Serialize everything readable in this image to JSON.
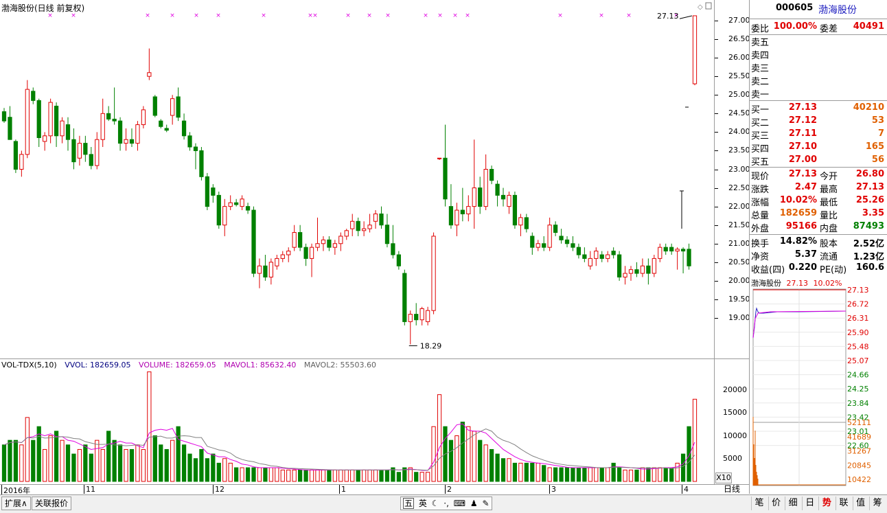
{
  "chart_header": {
    "title": "渤海股份(日线 前复权)",
    "last_price_label": "27.13",
    "low_label": "18.29"
  },
  "price_axis": [
    "27.00",
    "26.50",
    "26.00",
    "25.50",
    "25.00",
    "24.50",
    "24.00",
    "23.50",
    "23.00",
    "22.50",
    "22.00",
    "21.50",
    "21.00",
    "20.50",
    "20.00",
    "19.50",
    "19.00"
  ],
  "volume_header": {
    "indicator": "VOL-TDX(5,10)",
    "vvol": "VVOL: 182659.05",
    "volume": "VOLUME: 182659.05",
    "mavol1": "MAVOL1: 85632.40",
    "mavol2": "MAVOL2: 55503.60"
  },
  "volume_axis": [
    "20000",
    "15000",
    "10000",
    "5000"
  ],
  "x10_label": "X10",
  "date_axis": [
    "2016年",
    "11",
    "12",
    "1",
    "2",
    "3",
    "4"
  ],
  "period_label": "日线",
  "quote": {
    "code": "000605",
    "name": "渤海股份",
    "weibi_label": "委比",
    "weibi": "100.00%",
    "weicha_label": "委差",
    "weicha": "40491",
    "sell": [
      {
        "label": "卖五",
        "price": "",
        "vol": ""
      },
      {
        "label": "卖四",
        "price": "",
        "vol": ""
      },
      {
        "label": "卖三",
        "price": "",
        "vol": ""
      },
      {
        "label": "卖二",
        "price": "",
        "vol": ""
      },
      {
        "label": "卖一",
        "price": "",
        "vol": ""
      }
    ],
    "buy": [
      {
        "label": "买一",
        "price": "27.13",
        "vol": "40210"
      },
      {
        "label": "买二",
        "price": "27.12",
        "vol": "53"
      },
      {
        "label": "买三",
        "price": "27.11",
        "vol": "7"
      },
      {
        "label": "买四",
        "price": "27.10",
        "vol": "165"
      },
      {
        "label": "买五",
        "price": "27.00",
        "vol": "56"
      }
    ],
    "stats": [
      {
        "l1": "现价",
        "v1": "27.13",
        "c1": "red",
        "l2": "今开",
        "v2": "26.80",
        "c2": "red"
      },
      {
        "l1": "涨跌",
        "v1": "2.47",
        "c1": "red",
        "l2": "最高",
        "v2": "27.13",
        "c2": "red"
      },
      {
        "l1": "涨幅",
        "v1": "10.02%",
        "c1": "red",
        "l2": "最低",
        "v2": "25.26",
        "c2": "red"
      },
      {
        "l1": "总量",
        "v1": "182659",
        "c1": "orange",
        "l2": "量比",
        "v2": "3.35",
        "c2": "red"
      },
      {
        "l1": "外盘",
        "v1": "95166",
        "c1": "red",
        "l2": "内盘",
        "v2": "87493",
        "c2": "green"
      }
    ],
    "stats2": [
      {
        "l1": "换手",
        "v1": "14.82%",
        "l2": "股本",
        "v2": "2.52亿"
      },
      {
        "l1": "净资",
        "v1": "5.37",
        "l2": "流通",
        "v2": "1.23亿"
      },
      {
        "l1": "收益(四)",
        "v1": "0.220",
        "l2": "PE(动)",
        "v2": "160.6"
      }
    ]
  },
  "mini": {
    "name": "渤海股份",
    "price": "27.13",
    "pct": "10.02%",
    "price_axis": [
      "27.13",
      "26.72",
      "26.31",
      "25.90",
      "25.48",
      "25.07",
      "24.66",
      "24.25",
      "23.84",
      "23.42",
      "23.01",
      "22.60"
    ],
    "vol_axis": [
      "52111",
      "41689",
      "31267",
      "20845",
      "10422"
    ]
  },
  "bottom_tabs": {
    "expand": "扩展∧",
    "related": "关联报价"
  },
  "ime": {
    "mode": "五",
    "lang": "英",
    "moon": "☾",
    "dot": "·,",
    "kbd": "⌨",
    "person": "♟",
    "wrench": "✎"
  },
  "right_tabs": [
    "笔",
    "价",
    "细",
    "日",
    "势",
    "联",
    "值",
    "筹"
  ],
  "active_right_tab": "势",
  "chart_data": {
    "type": "candlestick",
    "title": "渤海股份(日线 前复权)",
    "x_ticks": [
      "2016年",
      "11",
      "12",
      "1",
      "2",
      "3",
      "4"
    ],
    "ylim": [
      18.5,
      27.2
    ],
    "volume_ylim": [
      0,
      24000
    ],
    "candles": [
      {
        "o": 24.55,
        "h": 24.65,
        "l": 24.25,
        "c": 24.3
      },
      {
        "o": 24.4,
        "h": 24.7,
        "l": 23.9,
        "c": 23.8
      },
      {
        "o": 23.75,
        "h": 23.8,
        "l": 22.9,
        "c": 23.0
      },
      {
        "o": 23.0,
        "h": 23.5,
        "l": 22.8,
        "c": 23.4
      },
      {
        "o": 23.4,
        "h": 25.4,
        "l": 23.3,
        "c": 25.15
      },
      {
        "o": 25.1,
        "h": 25.2,
        "l": 24.75,
        "c": 24.85
      },
      {
        "o": 24.85,
        "h": 24.9,
        "l": 23.6,
        "c": 23.85
      },
      {
        "o": 23.75,
        "h": 24.0,
        "l": 23.5,
        "c": 23.9
      },
      {
        "o": 23.9,
        "h": 24.9,
        "l": 23.7,
        "c": 24.8
      },
      {
        "o": 24.7,
        "h": 24.8,
        "l": 23.6,
        "c": 23.9
      },
      {
        "o": 23.9,
        "h": 24.4,
        "l": 23.7,
        "c": 24.3
      },
      {
        "o": 24.2,
        "h": 24.4,
        "l": 23.5,
        "c": 23.8
      },
      {
        "o": 23.8,
        "h": 24.1,
        "l": 23.0,
        "c": 23.2
      },
      {
        "o": 23.3,
        "h": 23.9,
        "l": 23.1,
        "c": 23.7
      },
      {
        "o": 23.7,
        "h": 23.9,
        "l": 23.2,
        "c": 23.4
      },
      {
        "o": 23.4,
        "h": 23.6,
        "l": 23.0,
        "c": 23.1
      },
      {
        "o": 23.1,
        "h": 24.0,
        "l": 23.0,
        "c": 23.8
      },
      {
        "o": 23.8,
        "h": 24.9,
        "l": 23.6,
        "c": 24.5
      },
      {
        "o": 24.5,
        "h": 24.7,
        "l": 24.3,
        "c": 24.35
      },
      {
        "o": 24.35,
        "h": 25.2,
        "l": 24.2,
        "c": 24.3
      },
      {
        "o": 24.3,
        "h": 24.4,
        "l": 23.5,
        "c": 23.7
      },
      {
        "o": 23.7,
        "h": 24.1,
        "l": 23.5,
        "c": 23.8
      },
      {
        "o": 23.8,
        "h": 24.1,
        "l": 23.6,
        "c": 23.7
      },
      {
        "o": 23.7,
        "h": 24.3,
        "l": 23.5,
        "c": 24.2
      },
      {
        "o": 24.2,
        "h": 24.7,
        "l": 24.1,
        "c": 24.6
      },
      {
        "o": 25.5,
        "h": 26.25,
        "l": 25.4,
        "c": 25.6
      },
      {
        "o": 24.95,
        "h": 25.0,
        "l": 24.4,
        "c": 24.45
      },
      {
        "o": 24.3,
        "h": 24.35,
        "l": 24.1,
        "c": 24.15
      },
      {
        "o": 24.1,
        "h": 24.2,
        "l": 24.0,
        "c": 24.05
      },
      {
        "o": 24.45,
        "h": 25.0,
        "l": 24.2,
        "c": 24.9
      },
      {
        "o": 24.95,
        "h": 25.2,
        "l": 24.3,
        "c": 24.4
      },
      {
        "o": 24.3,
        "h": 24.5,
        "l": 23.8,
        "c": 23.9
      },
      {
        "o": 23.9,
        "h": 24.0,
        "l": 23.5,
        "c": 23.6
      },
      {
        "o": 23.6,
        "h": 23.7,
        "l": 23.0,
        "c": 23.5
      },
      {
        "o": 23.5,
        "h": 23.6,
        "l": 22.7,
        "c": 22.8
      },
      {
        "o": 22.8,
        "h": 22.9,
        "l": 21.9,
        "c": 22.0
      },
      {
        "o": 22.5,
        "h": 22.6,
        "l": 22.1,
        "c": 22.3
      },
      {
        "o": 22.3,
        "h": 22.4,
        "l": 21.4,
        "c": 21.5
      },
      {
        "o": 21.5,
        "h": 22.2,
        "l": 21.2,
        "c": 22.0
      },
      {
        "o": 22.0,
        "h": 22.3,
        "l": 21.9,
        "c": 22.1
      },
      {
        "o": 22.1,
        "h": 22.2,
        "l": 22.0,
        "c": 22.05
      },
      {
        "o": 22.0,
        "h": 22.3,
        "l": 21.9,
        "c": 22.2
      },
      {
        "o": 22.0,
        "h": 22.1,
        "l": 21.8,
        "c": 21.9
      },
      {
        "o": 21.9,
        "h": 22.0,
        "l": 20.1,
        "c": 20.2
      },
      {
        "o": 20.2,
        "h": 20.6,
        "l": 19.8,
        "c": 20.4
      },
      {
        "o": 20.4,
        "h": 20.7,
        "l": 20.0,
        "c": 20.1
      },
      {
        "o": 20.1,
        "h": 20.6,
        "l": 19.9,
        "c": 20.5
      },
      {
        "o": 20.4,
        "h": 20.7,
        "l": 20.3,
        "c": 20.6
      },
      {
        "o": 20.6,
        "h": 20.8,
        "l": 20.5,
        "c": 20.7
      },
      {
        "o": 20.7,
        "h": 20.9,
        "l": 20.5,
        "c": 20.8
      },
      {
        "o": 20.9,
        "h": 21.5,
        "l": 20.8,
        "c": 21.3
      },
      {
        "o": 21.3,
        "h": 21.5,
        "l": 20.8,
        "c": 20.9
      },
      {
        "o": 20.9,
        "h": 21.0,
        "l": 20.4,
        "c": 20.6
      },
      {
        "o": 20.6,
        "h": 21.0,
        "l": 20.1,
        "c": 20.9
      },
      {
        "o": 20.9,
        "h": 21.7,
        "l": 20.8,
        "c": 21.0
      },
      {
        "o": 21.0,
        "h": 21.2,
        "l": 20.8,
        "c": 21.1
      },
      {
        "o": 21.1,
        "h": 21.2,
        "l": 20.8,
        "c": 20.9
      },
      {
        "o": 20.9,
        "h": 21.1,
        "l": 20.7,
        "c": 21.0
      },
      {
        "o": 21.0,
        "h": 21.3,
        "l": 20.8,
        "c": 21.2
      },
      {
        "o": 21.2,
        "h": 21.4,
        "l": 21.1,
        "c": 21.35
      },
      {
        "o": 21.4,
        "h": 21.8,
        "l": 21.2,
        "c": 21.6
      },
      {
        "o": 21.6,
        "h": 21.7,
        "l": 21.2,
        "c": 21.35
      },
      {
        "o": 21.35,
        "h": 21.6,
        "l": 21.2,
        "c": 21.4
      },
      {
        "o": 21.4,
        "h": 21.8,
        "l": 21.3,
        "c": 21.5
      },
      {
        "o": 21.6,
        "h": 21.9,
        "l": 21.4,
        "c": 21.8
      },
      {
        "o": 21.8,
        "h": 22.0,
        "l": 21.4,
        "c": 21.5
      },
      {
        "o": 21.5,
        "h": 21.8,
        "l": 20.9,
        "c": 21.0
      },
      {
        "o": 21.0,
        "h": 21.5,
        "l": 20.6,
        "c": 20.7
      },
      {
        "o": 20.7,
        "h": 20.8,
        "l": 20.3,
        "c": 20.4
      },
      {
        "o": 20.2,
        "h": 20.3,
        "l": 18.8,
        "c": 18.9
      },
      {
        "o": 18.9,
        "h": 19.2,
        "l": 18.29,
        "c": 19.1
      },
      {
        "o": 19.1,
        "h": 19.4,
        "l": 18.8,
        "c": 18.95
      },
      {
        "o": 18.95,
        "h": 19.3,
        "l": 18.8,
        "c": 19.25
      },
      {
        "o": 18.9,
        "h": 19.3,
        "l": 18.8,
        "c": 19.2
      },
      {
        "o": 19.2,
        "h": 21.3,
        "l": 19.1,
        "c": 21.2
      },
      {
        "o": 23.3,
        "h": 23.3,
        "l": 23.25,
        "c": 23.3
      },
      {
        "o": 23.3,
        "h": 24.2,
        "l": 22.0,
        "c": 22.2
      },
      {
        "o": 22.0,
        "h": 22.6,
        "l": 21.4,
        "c": 21.5
      },
      {
        "o": 21.5,
        "h": 22.1,
        "l": 21.2,
        "c": 21.9
      },
      {
        "o": 21.9,
        "h": 22.5,
        "l": 21.6,
        "c": 21.8
      },
      {
        "o": 21.8,
        "h": 22.3,
        "l": 21.6,
        "c": 22.0
      },
      {
        "o": 22.0,
        "h": 23.8,
        "l": 21.4,
        "c": 22.5
      },
      {
        "o": 22.5,
        "h": 22.8,
        "l": 21.8,
        "c": 22.0
      },
      {
        "o": 22.0,
        "h": 23.4,
        "l": 21.9,
        "c": 23.0
      },
      {
        "o": 23.0,
        "h": 23.1,
        "l": 22.6,
        "c": 22.7
      },
      {
        "o": 22.6,
        "h": 22.7,
        "l": 22.0,
        "c": 22.3
      },
      {
        "o": 22.3,
        "h": 22.5,
        "l": 22.0,
        "c": 22.2
      },
      {
        "o": 22.0,
        "h": 22.4,
        "l": 21.8,
        "c": 22.3
      },
      {
        "o": 22.3,
        "h": 22.4,
        "l": 21.4,
        "c": 21.5
      },
      {
        "o": 21.5,
        "h": 21.8,
        "l": 21.2,
        "c": 21.7
      },
      {
        "o": 21.7,
        "h": 21.8,
        "l": 21.3,
        "c": 21.4
      },
      {
        "o": 21.2,
        "h": 21.3,
        "l": 20.7,
        "c": 20.9
      },
      {
        "o": 20.9,
        "h": 21.1,
        "l": 20.8,
        "c": 21.0
      },
      {
        "o": 21.0,
        "h": 21.2,
        "l": 20.8,
        "c": 20.9
      },
      {
        "o": 20.9,
        "h": 21.7,
        "l": 20.8,
        "c": 21.5
      },
      {
        "o": 21.5,
        "h": 21.6,
        "l": 21.2,
        "c": 21.3
      },
      {
        "o": 21.2,
        "h": 21.4,
        "l": 21.0,
        "c": 21.1
      },
      {
        "o": 21.1,
        "h": 21.2,
        "l": 20.9,
        "c": 21.0
      },
      {
        "o": 21.0,
        "h": 21.2,
        "l": 20.8,
        "c": 20.9
      },
      {
        "o": 20.9,
        "h": 21.0,
        "l": 20.6,
        "c": 20.7
      },
      {
        "o": 20.7,
        "h": 20.9,
        "l": 20.5,
        "c": 20.6
      },
      {
        "o": 20.4,
        "h": 20.8,
        "l": 20.3,
        "c": 20.6
      },
      {
        "o": 20.6,
        "h": 20.9,
        "l": 20.4,
        "c": 20.8
      },
      {
        "o": 20.7,
        "h": 20.8,
        "l": 20.5,
        "c": 20.6
      },
      {
        "o": 20.6,
        "h": 20.8,
        "l": 20.5,
        "c": 20.7
      },
      {
        "o": 20.8,
        "h": 20.9,
        "l": 20.6,
        "c": 20.7
      },
      {
        "o": 20.7,
        "h": 20.8,
        "l": 20.0,
        "c": 20.1
      },
      {
        "o": 20.1,
        "h": 20.4,
        "l": 19.9,
        "c": 20.2
      },
      {
        "o": 20.2,
        "h": 20.4,
        "l": 20.0,
        "c": 20.3
      },
      {
        "o": 20.3,
        "h": 20.5,
        "l": 20.1,
        "c": 20.2
      },
      {
        "o": 20.2,
        "h": 20.6,
        "l": 20.1,
        "c": 20.4
      },
      {
        "o": 20.4,
        "h": 20.6,
        "l": 19.9,
        "c": 20.2
      },
      {
        "o": 20.2,
        "h": 20.7,
        "l": 20.1,
        "c": 20.6
      },
      {
        "o": 20.6,
        "h": 21.0,
        "l": 20.5,
        "c": 20.9
      },
      {
        "o": 20.9,
        "h": 21.0,
        "l": 20.7,
        "c": 20.8
      },
      {
        "o": 20.9,
        "h": 21.0,
        "l": 20.7,
        "c": 20.8
      },
      {
        "o": 20.8,
        "h": 20.9,
        "l": 20.3,
        "c": 20.85
      },
      {
        "o": 20.85,
        "h": 20.9,
        "l": 20.2,
        "c": 20.8
      },
      {
        "o": 20.85,
        "h": 21.0,
        "l": 20.3,
        "c": 20.4
      },
      {
        "o": 25.3,
        "h": 27.13,
        "l": 25.26,
        "c": 27.13
      }
    ],
    "volumes": [
      8,
      9,
      9,
      8,
      14,
      9,
      12,
      7,
      10,
      11,
      9,
      8,
      6,
      7,
      8,
      6,
      9,
      7,
      11,
      9,
      8,
      7,
      7,
      8,
      7,
      24,
      10,
      8,
      7,
      9,
      12,
      8,
      6,
      5,
      7,
      5,
      6,
      4,
      5,
      4,
      3,
      3,
      3,
      3,
      3,
      3,
      3,
      3,
      2.5,
      2.5,
      2.5,
      2.5,
      2.5,
      2.5,
      2.5,
      2.5,
      2.5,
      2.5,
      2.5,
      2.5,
      2.5,
      2.5,
      2.5,
      2.5,
      2.5,
      2.5,
      2.5,
      3,
      2,
      3,
      3,
      2,
      2,
      2,
      12,
      19,
      12,
      9,
      10,
      13,
      12,
      11,
      9,
      8,
      7,
      6,
      5,
      5,
      4,
      4,
      4,
      4,
      4,
      3.5,
      3,
      3,
      3,
      3,
      3,
      3,
      3,
      3,
      3,
      3,
      3,
      4,
      3,
      2.5,
      2.5,
      2.5,
      3,
      3,
      3,
      3,
      3,
      3,
      4,
      6,
      12,
      18
    ]
  }
}
